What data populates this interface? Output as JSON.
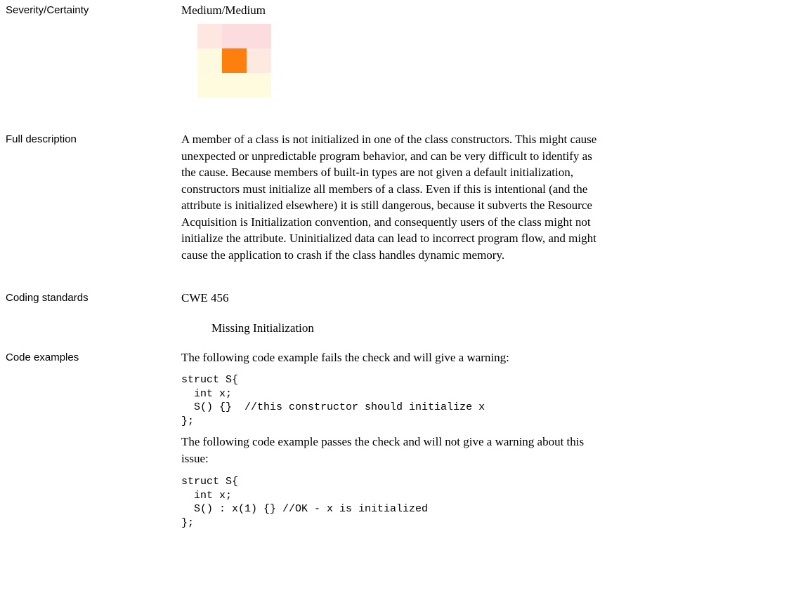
{
  "severity": {
    "label": "Severity/Certainty",
    "value": "Medium/Medium",
    "matrix_selected_cell": "center"
  },
  "full_description": {
    "label": "Full description",
    "lines": [
      "A member of a class is not initialized in one of the class constructors. This might cause",
      "unexpected or unpredictable program behavior, and can be very difficult to identify as",
      "the cause.  Because members of built-in types are not given a default initialization,",
      "constructors must initialize all members of a class.  Even if this is intentional (and the",
      "attribute is initialized elsewhere) it is still dangerous, because it subverts the Resource",
      "Acquisition is Initialization convention, and consequently users of the class might not",
      "initialize the attribute.  Uninitialized data can lead to incorrect program flow, and might",
      "cause the application to crash if the class handles dynamic memory."
    ]
  },
  "coding_standards": {
    "label": "Coding standards",
    "standard": "CWE 456",
    "description": "Missing Initialization"
  },
  "code_examples": {
    "label": "Code examples",
    "fail_intro": "The following code example fails the check and will give a warning:",
    "fail_code": "struct S{\n  int x;\n  S() {}  //this constructor should initialize x\n};",
    "pass_intro_lines": [
      "The following code example passes the check and will not give a warning about this",
      "issue:"
    ],
    "pass_code": "struct S{\n  int x;\n  S() : x(1) {} //OK - x is initialized\n};"
  }
}
